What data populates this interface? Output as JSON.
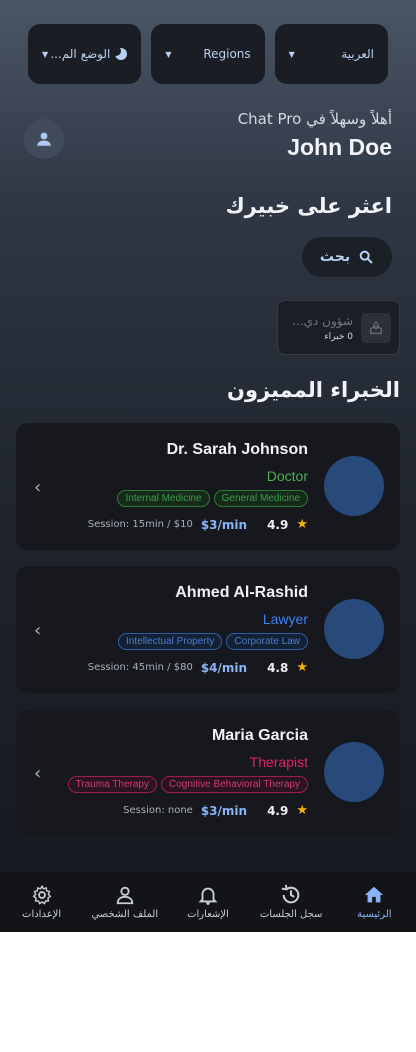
{
  "top_bar": {
    "language_label": "العربية",
    "region_label": "Regions",
    "theme_label": "الوضع الم..."
  },
  "greeting": {
    "welcome": "أهلاً وسهلاً في Chat Pro",
    "user_name": "John Doe"
  },
  "find_expert": {
    "title": "اعثر على خبيرك",
    "search_label": "بحث"
  },
  "categories": [
    {
      "name": "شؤون دي...",
      "count": "0 خبراء"
    }
  ],
  "featured": {
    "title": "الخبراء المميزون",
    "experts": [
      {
        "name": "Dr. Sarah Johnson",
        "role": "Doctor",
        "role_color": "#4caf50",
        "tags": [
          "General Medicine",
          "Internal Medicine"
        ],
        "tag_color": "#2f7a3a",
        "rating": "4.9",
        "price": "$3/min",
        "session": "Session: 15min / $10"
      },
      {
        "name": "Ahmed Al-Rashid",
        "role": "Lawyer",
        "role_color": "#3b82f6",
        "tags": [
          "Corporate Law",
          "Intellectual Property"
        ],
        "tag_color": "#2d5ea8",
        "rating": "4.8",
        "price": "$4/min",
        "session": "Session: 45min / $80"
      },
      {
        "name": "Maria Garcia",
        "role": "Therapist",
        "role_color": "#e91e63",
        "tags": [
          "Cognitive Behavioral Therapy",
          "Trauma Therapy"
        ],
        "tag_color": "#9e1e4a",
        "rating": "4.9",
        "price": "$3/min",
        "session": "Session: none"
      }
    ]
  },
  "bottom_nav": {
    "items": [
      {
        "label": "الرئيسية",
        "icon": "home-icon",
        "active": true
      },
      {
        "label": "سجل الجلسات",
        "icon": "history-icon",
        "active": false
      },
      {
        "label": "الإشعارات",
        "icon": "bell-icon",
        "active": false
      },
      {
        "label": "الملف الشخصي",
        "icon": "person-icon",
        "active": false
      },
      {
        "label": "الإعدادات",
        "icon": "gear-icon",
        "active": false
      }
    ]
  }
}
